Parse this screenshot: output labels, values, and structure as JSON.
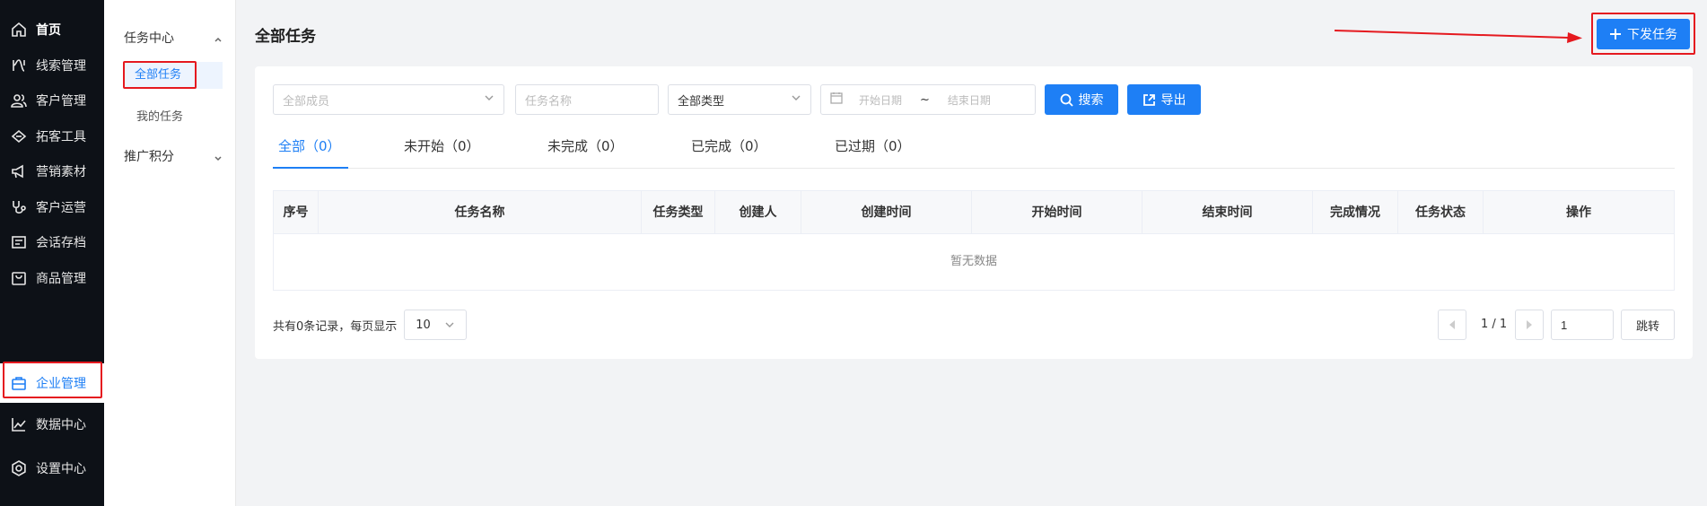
{
  "nav": {
    "items": [
      {
        "label": "首页",
        "icon": "home-icon"
      },
      {
        "label": "线索管理",
        "icon": "leads-icon"
      },
      {
        "label": "客户管理",
        "icon": "customers-icon"
      },
      {
        "label": "拓客工具",
        "icon": "tools-icon"
      },
      {
        "label": "营销素材",
        "icon": "megaphone-icon"
      },
      {
        "label": "客户运营",
        "icon": "stethoscope-icon"
      },
      {
        "label": "会话存档",
        "icon": "archive-icon"
      },
      {
        "label": "商品管理",
        "icon": "shopping-bag-icon"
      },
      {
        "label": "企业管理",
        "icon": "briefcase-icon"
      },
      {
        "label": "数据中心",
        "icon": "line-chart-icon"
      },
      {
        "label": "设置中心",
        "icon": "settings-icon"
      }
    ]
  },
  "submenu": {
    "group1": "任务中心",
    "item_all": "全部任务",
    "item_mine": "我的任务",
    "group2": "推广积分"
  },
  "header": {
    "title": "全部任务",
    "issue_button": "下发任务"
  },
  "filters": {
    "member_placeholder": "全部成员",
    "task_name_placeholder": "任务名称",
    "type_value": "全部类型",
    "start_date_placeholder": "开始日期",
    "date_separator": "~",
    "end_date_placeholder": "结束日期",
    "search_label": "搜索",
    "export_label": "导出"
  },
  "tabs": [
    {
      "label": "全部（0）"
    },
    {
      "label": "未开始（0）"
    },
    {
      "label": "未完成（0）"
    },
    {
      "label": "已完成（0）"
    },
    {
      "label": "已过期（0）"
    }
  ],
  "table": {
    "columns": [
      "序号",
      "任务名称",
      "任务类型",
      "创建人",
      "创建时间",
      "开始时间",
      "结束时间",
      "完成情况",
      "任务状态",
      "操作"
    ],
    "empty_text": "暂无数据"
  },
  "pagination": {
    "summary": "共有0条记录，每页显示",
    "page_size": "10",
    "page_info": "1 / 1",
    "jump_value": "1",
    "jump_label": "跳转"
  },
  "colors": {
    "primary": "#1e7ff5",
    "nav_bg": "#0d1117",
    "annotation_red": "#e5191f"
  }
}
